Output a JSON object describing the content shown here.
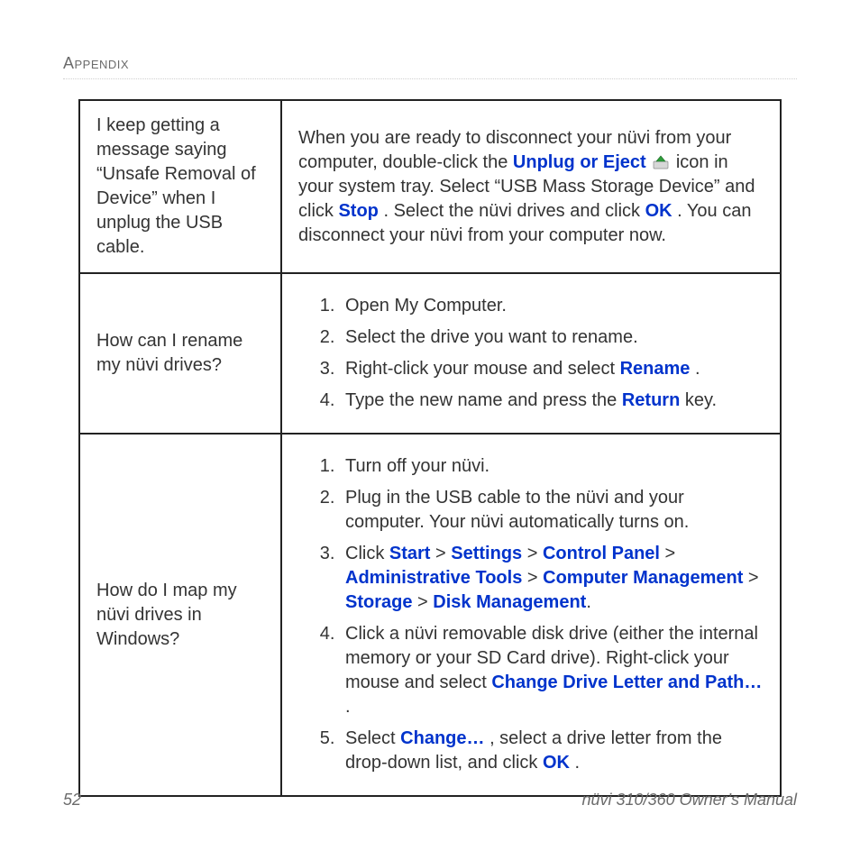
{
  "section_header": "Appendix",
  "footer": {
    "page_number": "52",
    "manual_title": "nüvi 310/360 Owner’s Manual"
  },
  "rows": [
    {
      "question": "I keep getting a message saying “Unsafe Removal of Device” when I unplug the USB cable.",
      "answer": {
        "t1": "When you are ready to disconnect your nüvi from your computer, double-click the ",
        "b1": "Unplug or Eject",
        "t2": " icon in your system tray. Select “USB Mass Storage Device” and click ",
        "b2": "Stop",
        "t3": ". Select the nüvi drives and click ",
        "b3": "OK",
        "t4": ". You can disconnect your nüvi from your computer now."
      }
    },
    {
      "question": "How can I rename my nüvi drives?",
      "steps": [
        {
          "t1": "Open My Computer."
        },
        {
          "t1": "Select the drive you want to rename."
        },
        {
          "t1": "Right-click your mouse and select ",
          "b1": "Rename",
          "t2": "."
        },
        {
          "t1": "Type the new name and press the ",
          "b1": "Return",
          "t2": " key."
        }
      ]
    },
    {
      "question": "How do I map my nüvi drives in Windows?",
      "steps": [
        {
          "t1": "Turn off your nüvi."
        },
        {
          "t1": "Plug in the USB cable to the nüvi and your computer. Your nüvi automatically turns on."
        },
        {
          "t1": "Click ",
          "b1": "Start",
          "s1": " > ",
          "b2": "Settings",
          "s2": " > ",
          "b3": "Control Panel",
          "s3": " > ",
          "b4": "Administrative Tools",
          "s4": " > ",
          "b5": "Computer Management",
          "s5": " > ",
          "b6": "Storage",
          "s6": " > ",
          "b7": "Disk Management",
          "t2": "."
        },
        {
          "t1": "Click a nüvi removable disk drive (either the internal memory or your SD Card drive). Right-click your mouse and select ",
          "b1": "Change Drive Letter and Path…",
          "t2": "."
        },
        {
          "t1": "Select ",
          "b1": "Change…",
          "t2": ", select a drive letter from the drop-down list, and click ",
          "b2": "OK",
          "t3": "."
        }
      ]
    }
  ]
}
